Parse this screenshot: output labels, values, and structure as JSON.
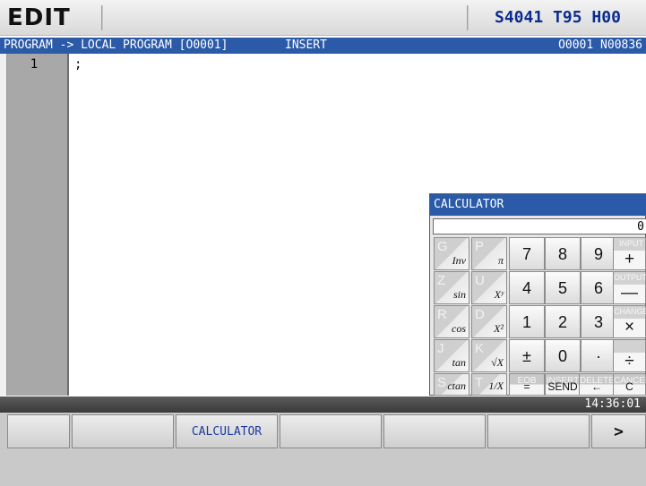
{
  "header": {
    "mode": "EDIT",
    "spindle_s": "S4041",
    "tool_t": "T95",
    "h_code": "H00"
  },
  "pathbar": {
    "path": "PROGRAM -> LOCAL PROGRAM [O0001]",
    "edit_mode": "INSERT",
    "program_number": "O0001 N00836"
  },
  "editor": {
    "line_number": "1",
    "content": ";"
  },
  "calculator": {
    "title": "CALCULATOR",
    "display": "0",
    "function_keys": [
      {
        "secondary": "G",
        "primary": "Inv"
      },
      {
        "secondary": "P",
        "primary": "π"
      },
      {
        "secondary": "Z",
        "primary": "sin"
      },
      {
        "secondary": "U",
        "primary": "Xʸ"
      },
      {
        "secondary": "R",
        "primary": "cos"
      },
      {
        "secondary": "D",
        "primary": "X²"
      },
      {
        "secondary": "J",
        "primary": "tan"
      },
      {
        "secondary": "K",
        "primary": "√X"
      },
      {
        "secondary": "S",
        "primary": "ctan"
      },
      {
        "secondary": "T",
        "primary": "1/X"
      }
    ],
    "num_keys": [
      "7",
      "8",
      "9",
      "4",
      "5",
      "6",
      "1",
      "2",
      "3",
      "±",
      "0",
      "·"
    ],
    "edit_keys": [
      {
        "top": "INPUT",
        "symbol": "+"
      },
      {
        "top": "OUTPUT",
        "symbol": "—"
      },
      {
        "top": "CHANGE",
        "symbol": "×"
      },
      {
        "top": "",
        "symbol": "÷"
      }
    ],
    "bottom_keys": [
      {
        "top": "EOB",
        "symbol": "="
      },
      {
        "top": "INSERT",
        "symbol": "SEND"
      },
      {
        "top": "DELETE",
        "symbol": "←"
      },
      {
        "top": "CANCEL",
        "symbol": "C"
      }
    ]
  },
  "status": {
    "time": "14:36:01"
  },
  "softkeys": [
    "",
    "",
    "CALCULATOR",
    "",
    "",
    "",
    ">"
  ]
}
